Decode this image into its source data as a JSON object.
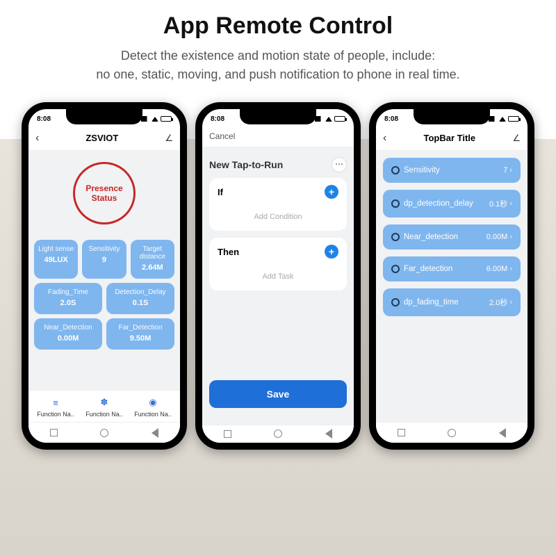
{
  "header": {
    "title": "App Remote Control",
    "subtitle": "Detect the existence and motion state of people, include:\nno one, static, moving, and push notification to phone in real time."
  },
  "status": {
    "time": "8:08"
  },
  "phone1": {
    "topbar_title": "ZSVIOT",
    "presence_label": "Presence\nStatus",
    "tiles": [
      {
        "label": "Light sense",
        "value": "49LUX"
      },
      {
        "label": "Sensitivity",
        "value": "9"
      },
      {
        "label": "Target distance",
        "value": "2.64M"
      },
      {
        "label": "Fading_Time",
        "value": "2.0S"
      },
      {
        "label": "Detection_Delay",
        "value": "0.1S"
      },
      {
        "label": "Near_Detection",
        "value": "0.00M"
      },
      {
        "label": "Far_Detection",
        "value": "9.50M"
      }
    ],
    "functions": [
      {
        "icon": "≡",
        "color": "#2e6fd9",
        "label": "Function Na.."
      },
      {
        "icon": "✽",
        "color": "#2e6fd9",
        "label": "Function Na.."
      },
      {
        "icon": "◉",
        "color": "#2e6fd9",
        "label": "Function Na.."
      }
    ]
  },
  "phone2": {
    "cancel": "Cancel",
    "title": "New Tap-to-Run",
    "if_label": "If",
    "add_condition": "Add Condition",
    "then_label": "Then",
    "add_task": "Add Task",
    "save": "Save"
  },
  "phone3": {
    "topbar_title": "TopBar Title",
    "rows": [
      {
        "label": "Sensitivity",
        "value": "7"
      },
      {
        "label": "dp_detection_delay",
        "value": "0.1秒"
      },
      {
        "label": "Near_detection",
        "value": "0.00M"
      },
      {
        "label": "Far_detection",
        "value": "6.00M"
      },
      {
        "label": "dp_fading_time",
        "value": "2.0秒"
      }
    ]
  }
}
